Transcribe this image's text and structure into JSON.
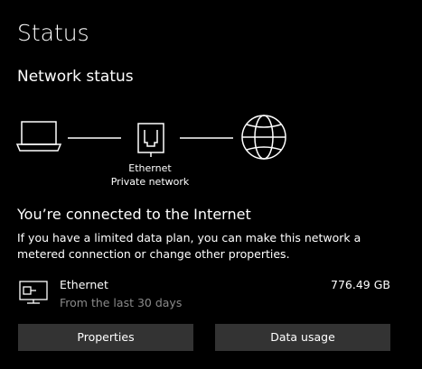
{
  "page": {
    "title": "Status"
  },
  "network_status": {
    "heading": "Network status",
    "diagram": {
      "adapter_label": "Ethernet",
      "network_label": "Private network"
    }
  },
  "connection": {
    "heading": "You’re connected to the Internet",
    "description": "If you have a limited data plan, you can make this network a metered connection or change other properties."
  },
  "usage": {
    "adapter_name": "Ethernet",
    "period": "From the last 30 days",
    "amount": "776.49 GB"
  },
  "buttons": {
    "properties": "Properties",
    "data_usage": "Data usage"
  },
  "colors": {
    "background": "#000000",
    "text": "#ffffff",
    "secondary_text": "#8a8a8a",
    "button_background": "#333333"
  },
  "icons": {
    "device": "laptop-icon",
    "adapter": "ethernet-port-icon",
    "internet": "globe-icon",
    "usage": "ethernet-computer-icon"
  }
}
